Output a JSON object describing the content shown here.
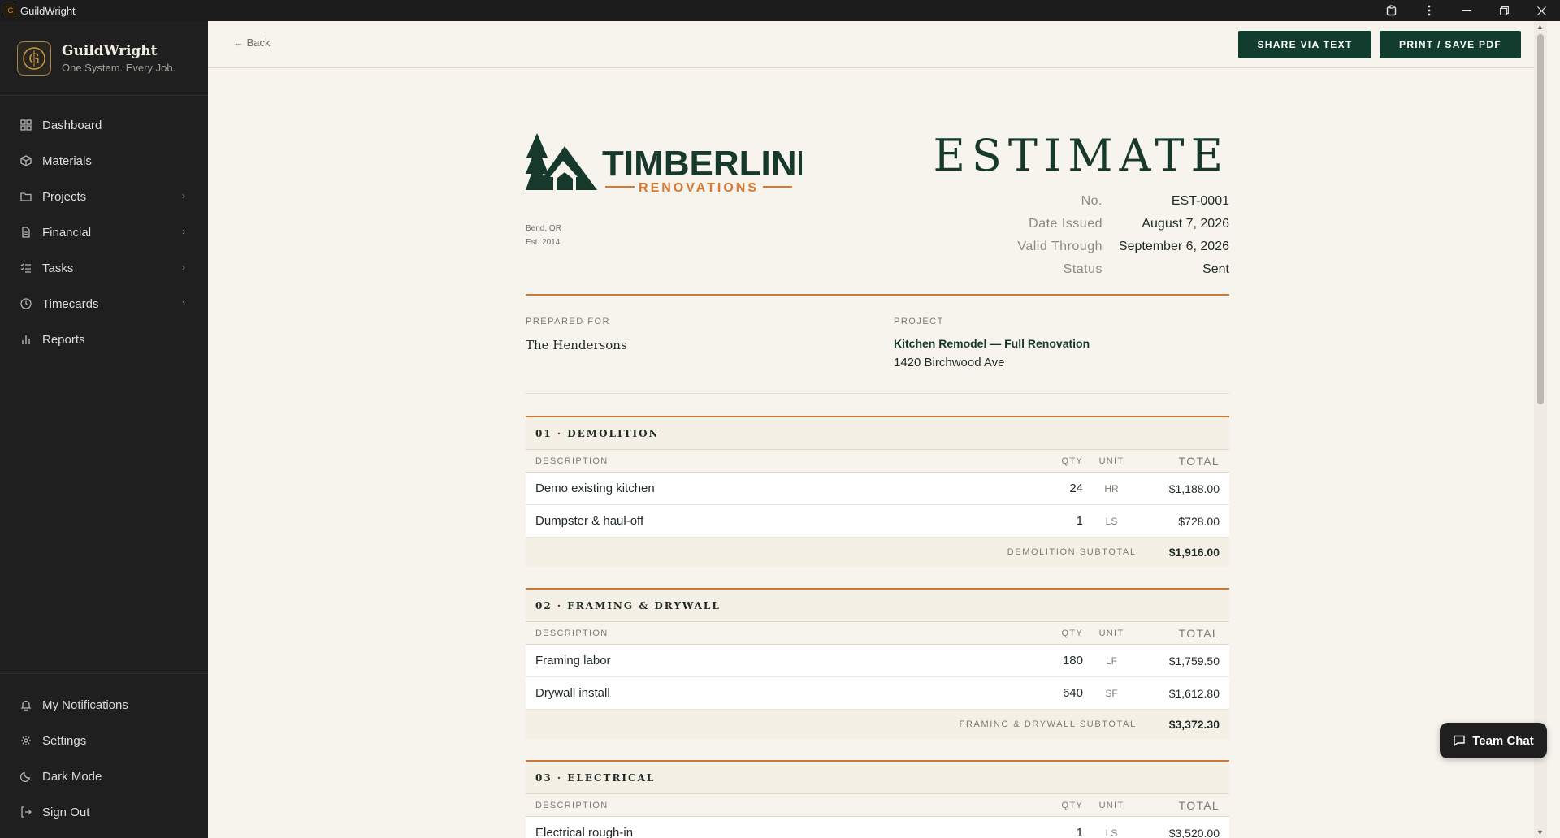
{
  "window": {
    "title": "GuildWright",
    "app_icon_glyph": "G"
  },
  "sidebar": {
    "brand_name": "GuildWright",
    "brand_tagline": "One System. Every Job.",
    "items": [
      {
        "label": "Dashboard",
        "icon": "grid-icon",
        "chevron": false
      },
      {
        "label": "Materials",
        "icon": "box-icon",
        "chevron": false
      },
      {
        "label": "Projects",
        "icon": "folder-icon",
        "chevron": true
      },
      {
        "label": "Financial",
        "icon": "document-icon",
        "chevron": true
      },
      {
        "label": "Tasks",
        "icon": "list-icon",
        "chevron": true
      },
      {
        "label": "Timecards",
        "icon": "clock-icon",
        "chevron": true
      },
      {
        "label": "Reports",
        "icon": "bar-chart-icon",
        "chevron": false
      }
    ],
    "bottom_items": [
      {
        "label": "My Notifications",
        "icon": "bell-icon"
      },
      {
        "label": "Settings",
        "icon": "gear-icon"
      },
      {
        "label": "Dark Mode",
        "icon": "moon-icon"
      },
      {
        "label": "Sign Out",
        "icon": "sign-out-icon"
      }
    ]
  },
  "topbar": {
    "back_label": "← Back",
    "share_label": "SHARE VIA TEXT",
    "print_label": "PRINT / SAVE PDF"
  },
  "company": {
    "name": "TIMBERLINE",
    "subname": "RENOVATIONS",
    "city": "Bend, OR",
    "established": "Est. 2014"
  },
  "estimate": {
    "title": "ESTIMATE",
    "meta": [
      {
        "label": "No.",
        "value": "EST-0001"
      },
      {
        "label": "Date Issued",
        "value": "August 7, 2026"
      },
      {
        "label": "Valid Through",
        "value": "September 6, 2026"
      },
      {
        "label": "Status",
        "value": "Sent"
      }
    ],
    "prepared_for_label": "PREPARED FOR",
    "client": "The Hendersons",
    "project_label": "PROJECT",
    "project_name": "Kitchen Remodel — Full Renovation",
    "project_address": "1420 Birchwood Ave",
    "columns": {
      "description": "DESCRIPTION",
      "qty": "QTY",
      "unit": "UNIT",
      "total": "TOTAL"
    },
    "sections": [
      {
        "title": "01 · DEMOLITION",
        "rows": [
          {
            "description": "Demo existing kitchen",
            "qty": "24",
            "unit": "HR",
            "total": "$1,188.00"
          },
          {
            "description": "Dumpster & haul-off",
            "qty": "1",
            "unit": "LS",
            "total": "$728.00"
          }
        ],
        "subtotal_label": "DEMOLITION SUBTOTAL",
        "subtotal": "$1,916.00"
      },
      {
        "title": "02 · FRAMING & DRYWALL",
        "rows": [
          {
            "description": "Framing labor",
            "qty": "180",
            "unit": "LF",
            "total": "$1,759.50"
          },
          {
            "description": "Drywall install",
            "qty": "640",
            "unit": "SF",
            "total": "$1,612.80"
          }
        ],
        "subtotal_label": "FRAMING & DRYWALL SUBTOTAL",
        "subtotal": "$3,372.30"
      },
      {
        "title": "03 · ELECTRICAL",
        "rows": [
          {
            "description": "Electrical rough-in",
            "qty": "1",
            "unit": "LS",
            "total": "$3,520.00"
          }
        ]
      }
    ]
  },
  "team_chat_label": "Team Chat",
  "colors": {
    "brand_green": "#123d2e",
    "accent_orange": "#c9783a",
    "sidebar_bg": "#1f1f1f",
    "page_bg": "#f7f4ee"
  }
}
